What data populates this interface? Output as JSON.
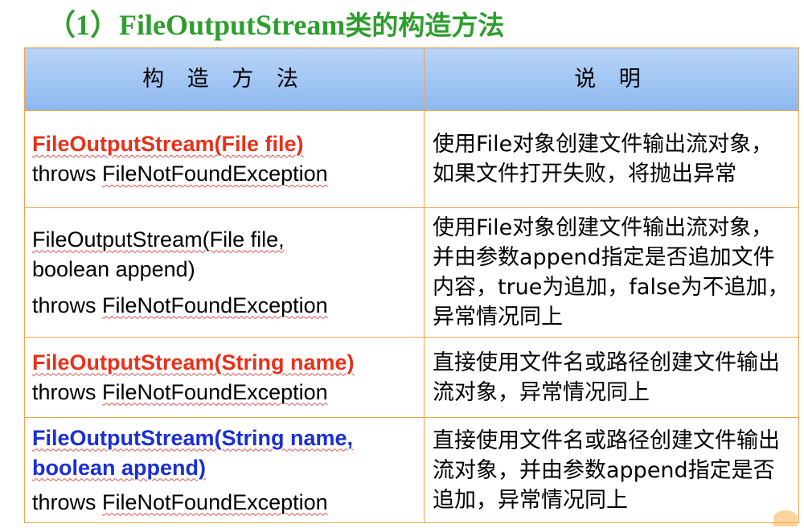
{
  "title": {
    "prefix": "（1）",
    "class_name": "FileOutputStream",
    "suffix": "类的构造方法"
  },
  "table": {
    "headers": [
      "构 造 方 法",
      "说    明"
    ],
    "rows": [
      {
        "sig_lines": [
          "FileOutputStream(File file)",
          "throws FileNotFoundException"
        ],
        "desc": "使用File对象创建文件输出流对象，如果文件打开失败，将抛出异常"
      },
      {
        "sig_lines": [
          "FileOutputStream(File file,",
          "boolean append)",
          "throws FileNotFoundException"
        ],
        "desc": "使用File对象创建文件输出流对象，并由参数append指定是否追加文件内容，true为追加，false为不追加，异常情况同上"
      },
      {
        "sig_lines": [
          "FileOutputStream(String name)",
          "throws FileNotFoundException"
        ],
        "desc": "直接使用文件名或路径创建文件输出流对象，异常情况同上"
      },
      {
        "sig_lines": [
          "FileOutputStream(String name,",
          "boolean append)",
          "throws FileNotFoundException"
        ],
        "desc": "直接使用文件名或路径创建文件输出流对象，并由参数append指定是否追加，异常情况同上"
      }
    ]
  },
  "colors": {
    "title": "#2e9e2e",
    "header_bg": "#a9caf3",
    "border": "#f0a246",
    "red_sig": "#e8301a",
    "blue_sig": "#1a2fd6"
  }
}
